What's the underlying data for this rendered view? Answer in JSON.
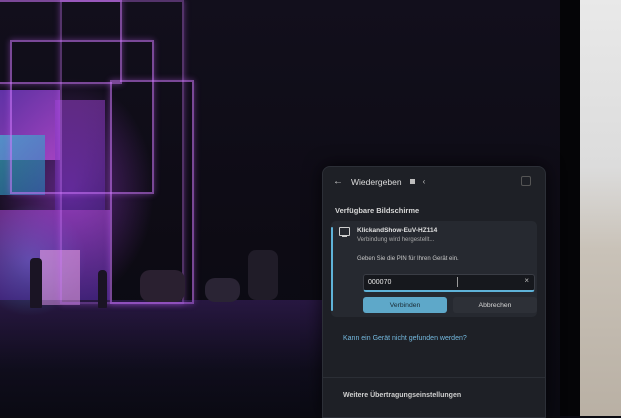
{
  "panel": {
    "header_title": "Wiedergeben",
    "section_title": "Verfügbare Bildschirme",
    "device": {
      "name": "KlickandShow-EuV-HZ114",
      "status": "Verbindung wird hergestellt...",
      "pin_prompt": "Geben Sie die PIN für Ihren Gerät ein.",
      "pin_value": "000070",
      "connect_label": "Verbinden",
      "cancel_label": "Abbrechen"
    },
    "not_found_link": "Kann ein Gerät nicht gefunden werden?",
    "more_settings": "Weitere Übertragungseinstellungen"
  },
  "colors": {
    "accent": "#5ea8c9",
    "panel_bg": "#1e2026",
    "link": "#74b9df"
  },
  "icons": [
    "back-arrow-icon",
    "cast-icon",
    "chevron-icon",
    "monitor-icon",
    "clear-icon"
  ]
}
